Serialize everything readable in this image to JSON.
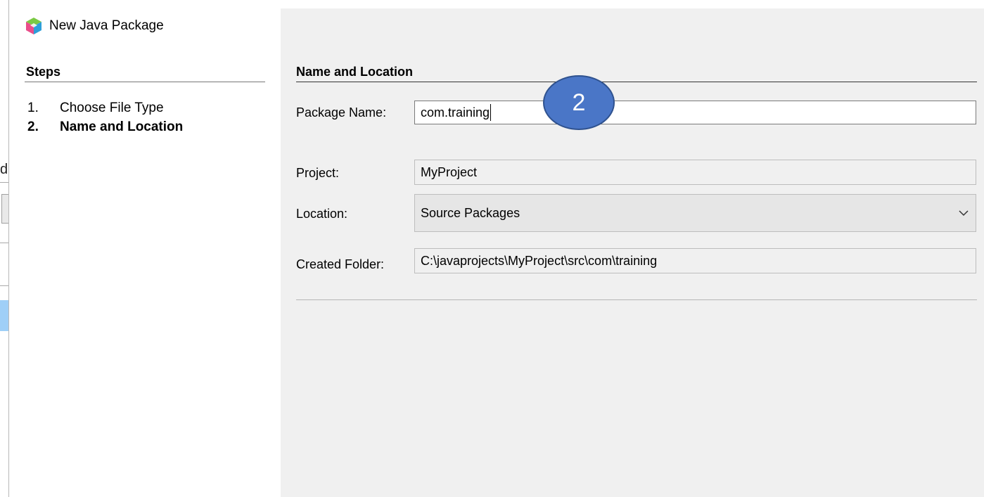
{
  "dialog": {
    "title": "New Java Package",
    "icon": "netbeans-cube-icon",
    "close_symbol": "×"
  },
  "background_window": {
    "fragment_text": "d"
  },
  "steps": {
    "heading": "Steps",
    "items": [
      {
        "number": "1.",
        "label": "Choose File Type",
        "current": false
      },
      {
        "number": "2.",
        "label": "Name and Location",
        "current": true
      }
    ]
  },
  "form": {
    "heading": "Name and Location",
    "package_name": {
      "label": "Package Name:",
      "value": "com.training"
    },
    "project": {
      "label": "Project:",
      "value": "MyProject"
    },
    "location": {
      "label": "Location:",
      "value": "Source Packages"
    },
    "created_folder": {
      "label": "Created Folder:",
      "value": "C:\\javaprojects\\MyProject\\src\\com\\training"
    }
  },
  "callout": {
    "number": "2"
  },
  "colors": {
    "callout_fill": "#4a76c7",
    "callout_border": "#2f528f",
    "content_bg": "#f0f0f0",
    "selection_blue": "#9fcff7"
  }
}
